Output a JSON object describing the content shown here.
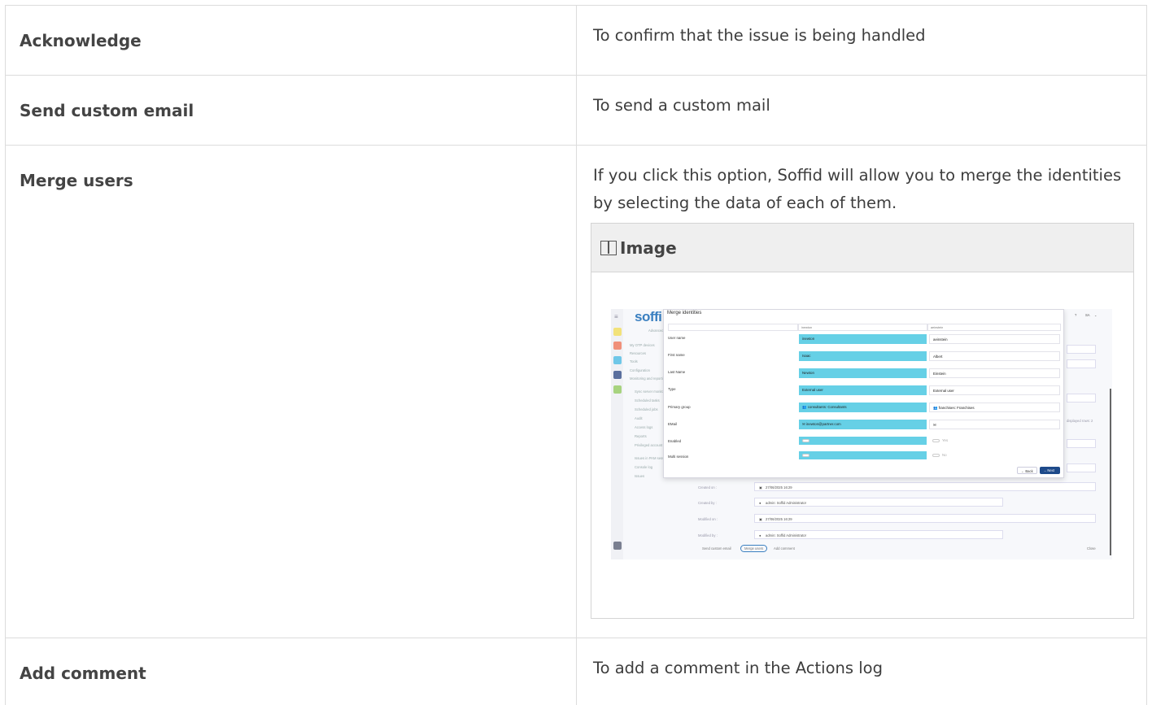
{
  "rows": [
    {
      "action": "Acknowledge",
      "description": "To confirm that the issue is being handled"
    },
    {
      "action": "Send custom email",
      "description": "To send a custom mail"
    },
    {
      "action": "Merge users",
      "description": "If you click this option, Soffid will allow you to merge the identities by selecting the data of each of them."
    },
    {
      "action": "Add comment",
      "description": "To add a comment in the Actions log"
    }
  ],
  "image_box": {
    "title": "Image",
    "icon": "image-icon"
  },
  "screenshot": {
    "logo": "soffi",
    "sidebar": [
      "Advanced",
      "My OTP devices",
      "Resources",
      "Tools",
      "Configuration",
      "Monitoring and reporting",
      "Sync server monitoring",
      "Scheduled tasks",
      "Scheduled jobs",
      "Audit",
      "Access logs",
      "Reports",
      "Privileged account management",
      "Issues in PAM session",
      "Console log",
      "Issues"
    ],
    "modal": {
      "title": "Merge identities",
      "col_a": "inewton",
      "col_b": "aeinstein",
      "rows": [
        {
          "label": "User name",
          "a": "inewton",
          "b": "aeinstein"
        },
        {
          "label": "First name",
          "a": "Isaac",
          "b": "Albert"
        },
        {
          "label": "Last Name",
          "a": "Newton",
          "b": "Einstein"
        },
        {
          "label": "Type",
          "a": "External user",
          "b": "External user"
        },
        {
          "label": "Primary group",
          "a": "consultants: Consultants",
          "b": "franchises: Franchises"
        },
        {
          "label": "EMail",
          "a": "inewton@partner.com",
          "b": ""
        },
        {
          "label": "Enabled",
          "a": "Yes",
          "b": "Yes"
        },
        {
          "label": "Multi session",
          "a": "No",
          "b": "No"
        }
      ],
      "back_label": "Back",
      "next_label": "Next"
    },
    "background_fields": [
      {
        "label": "Created on :",
        "value": "27/06/2025 16:29"
      },
      {
        "label": "Created by :",
        "value": "admin: Soffid Administrator"
      },
      {
        "label": "Modified on :",
        "value": "27/06/2025 16:29"
      },
      {
        "label": "Modified by :",
        "value": "admin: Soffid Administrator"
      }
    ],
    "footer": {
      "send_email": "Send custom email",
      "merge_users": "Merge users",
      "add_comment": "Add comment",
      "close": "Close"
    },
    "top_right": "SA",
    "displayed_rows": "displayed rows: 2"
  }
}
